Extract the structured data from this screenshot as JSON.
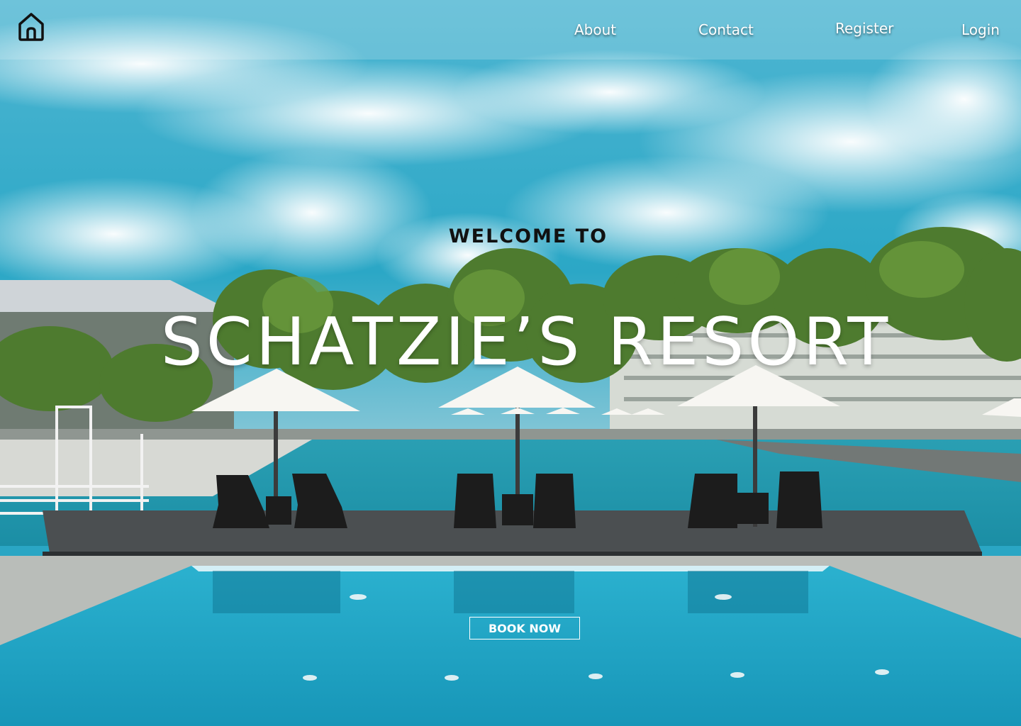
{
  "nav": {
    "home_icon": "home-icon",
    "links": [
      {
        "label": "About"
      },
      {
        "label": "Contact"
      },
      {
        "label": "Register"
      },
      {
        "label": "Login"
      }
    ]
  },
  "hero": {
    "welcome": "WELCOME TO",
    "title": "SCHATZIE’S RESORT",
    "cta": "BOOK NOW"
  },
  "colors": {
    "sky": "#2aa6c4",
    "pool": "#1b9fbb",
    "text": "#ffffff",
    "welcome_text": "#111111"
  }
}
